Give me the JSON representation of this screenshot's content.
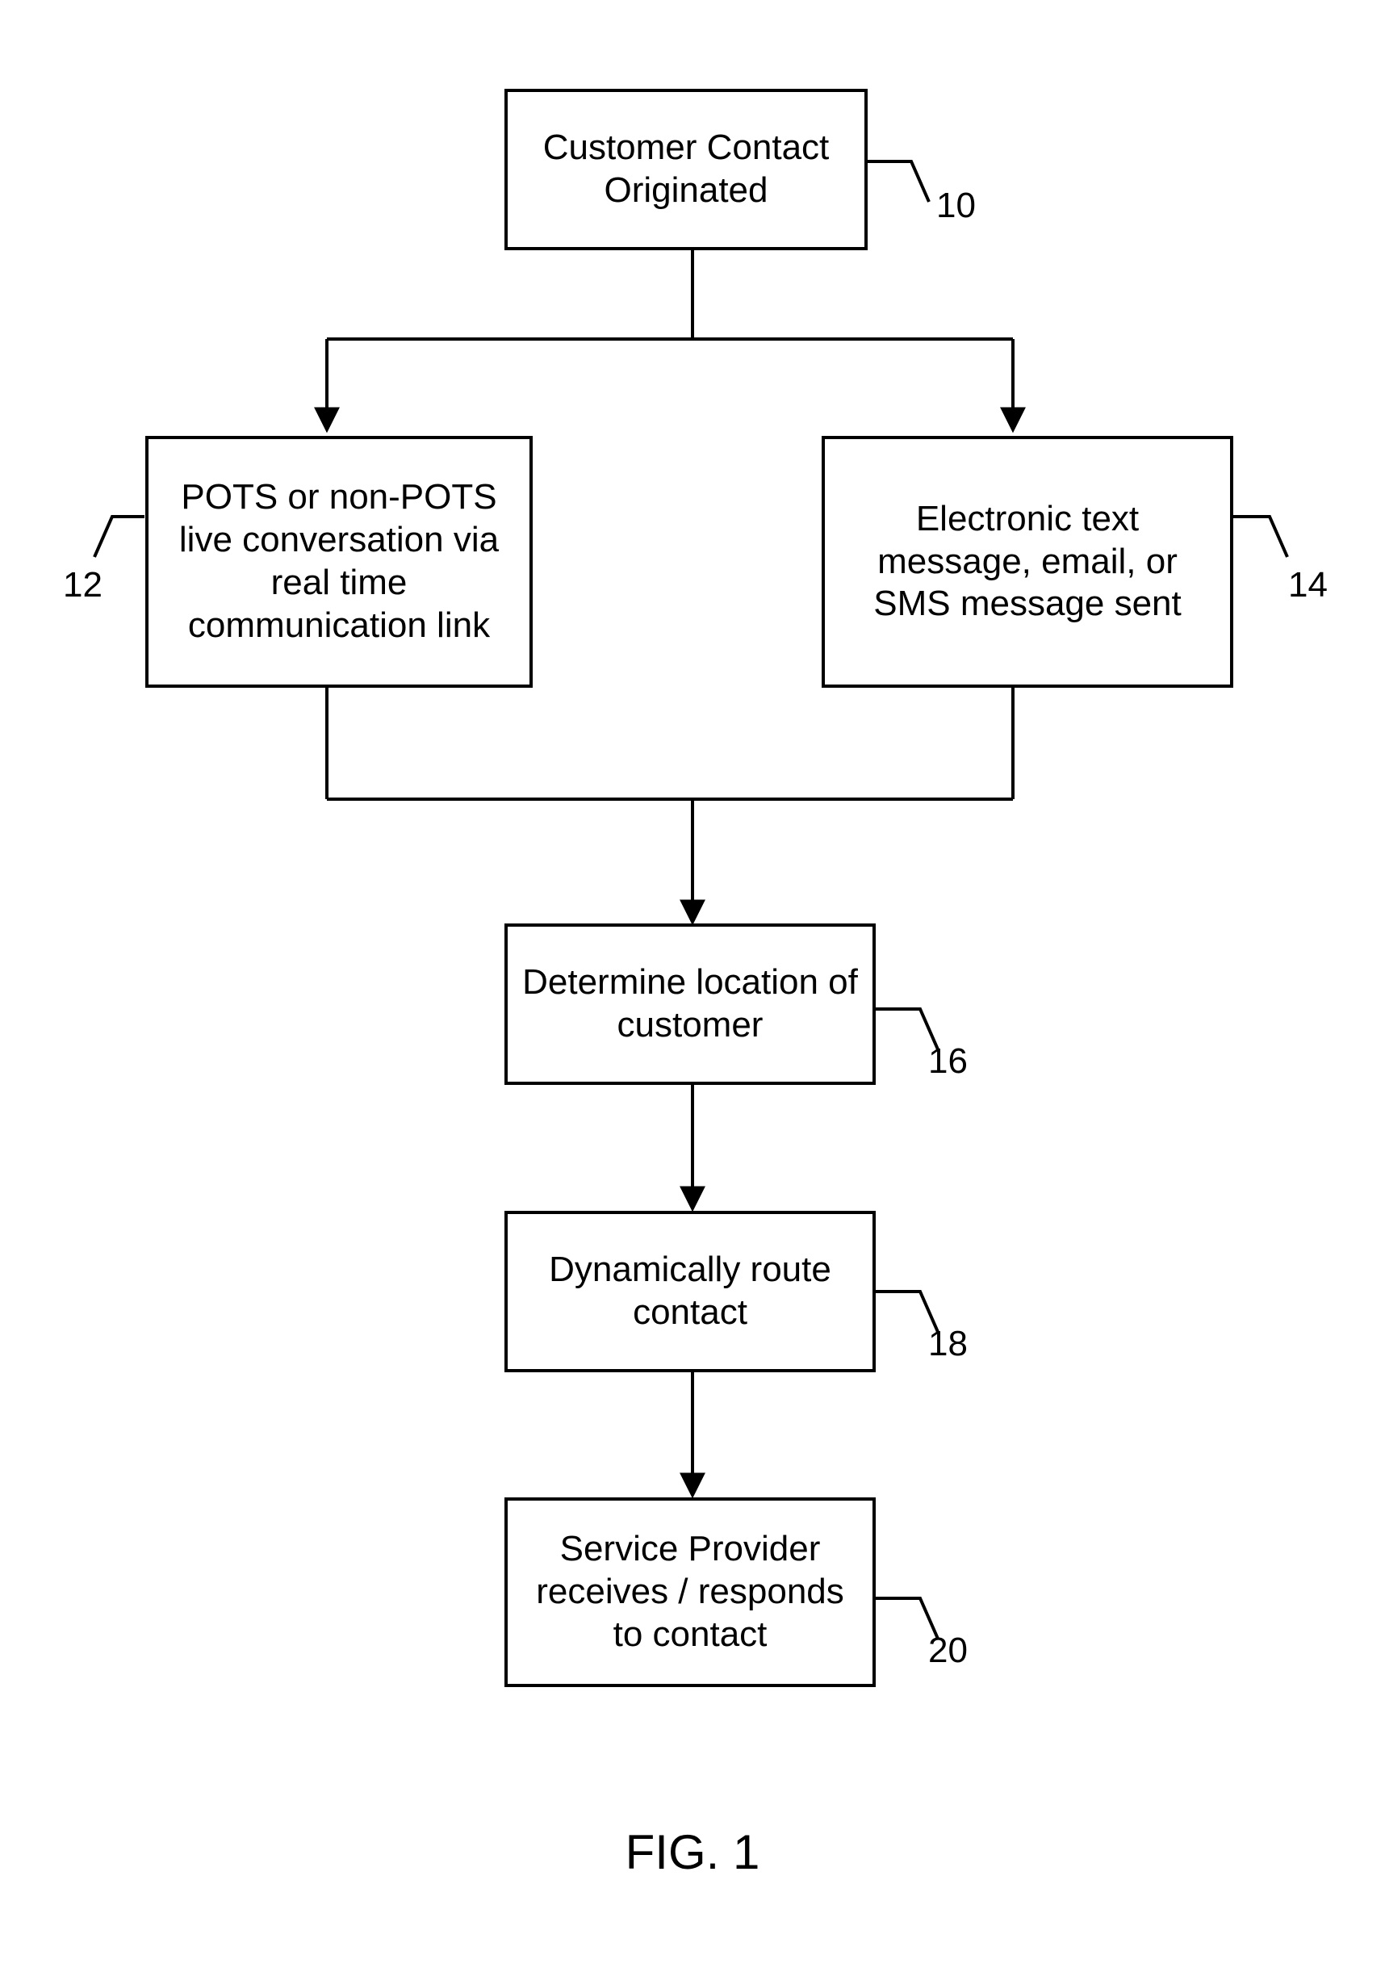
{
  "figure_label": "FIG. 1",
  "boxes": {
    "b10": {
      "text": "Customer Contact Originated",
      "ref": "10"
    },
    "b12": {
      "text": "POTS or non-POTS live conversation via real time communication link",
      "ref": "12"
    },
    "b14": {
      "text": "Electronic text message, email, or SMS message sent",
      "ref": "14"
    },
    "b16": {
      "text": "Determine location of customer",
      "ref": "16"
    },
    "b18": {
      "text": "Dynamically route contact",
      "ref": "18"
    },
    "b20": {
      "text": "Service Provider receives / responds to contact",
      "ref": "20"
    }
  }
}
